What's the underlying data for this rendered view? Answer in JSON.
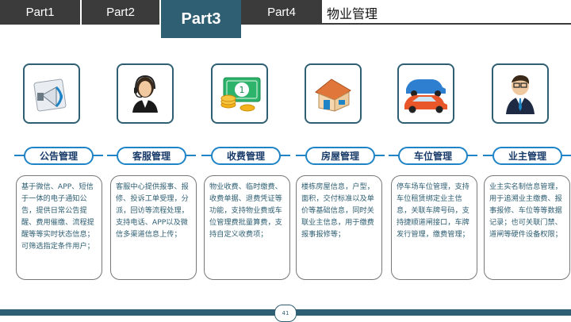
{
  "nav": {
    "tabs": [
      "Part1",
      "Part2",
      "Part3",
      "Part4"
    ],
    "active_index": 2,
    "title": "物业管理"
  },
  "modules": [
    {
      "icon": "megaphone-icon",
      "title": "公告管理",
      "desc": "基于微信、APP、短信于一体的电子通知公告，提供日常公告提醒、费用催缴、流程提醒等等实时状态信息；可筛选指定条件用户；"
    },
    {
      "icon": "headset-agent-icon",
      "title": "客服管理",
      "desc": "客服中心提供报事、报修、投诉工单受理，分派，回访等流程处理，支持电话、APP以及微信多渠道信息上传；"
    },
    {
      "icon": "money-coins-icon",
      "title": "收费管理",
      "desc": "物业收费、临时缴费、收费单据、退费凭证等功能，支持物业费或车位管理费批量算费，支持自定义收费项；"
    },
    {
      "icon": "house-icon",
      "title": "房屋管理",
      "desc": "楼栋房屋信息，户型，面积，交付标准以及单价等基础信息，同时关联业主信息，用于缴费报事报修等；"
    },
    {
      "icon": "cars-icon",
      "title": "车位管理",
      "desc": "停车场车位管理，支持车位租赁绑定业主信息，关联车牌号码，支持捷顺道闸接口，车牌发行管理，缴费管理；"
    },
    {
      "icon": "businessman-icon",
      "title": "业主管理",
      "desc": "业主实名制信息管理，用于追溯业主缴费、报事报修、车位等等数据记录；也可关联门禁、道闸等硬件设备权限；"
    }
  ],
  "footer": {
    "page_number": "41"
  },
  "colors": {
    "dark": "#3b3b3b",
    "teal": "#2f5f73",
    "blue": "#1f84c6"
  }
}
